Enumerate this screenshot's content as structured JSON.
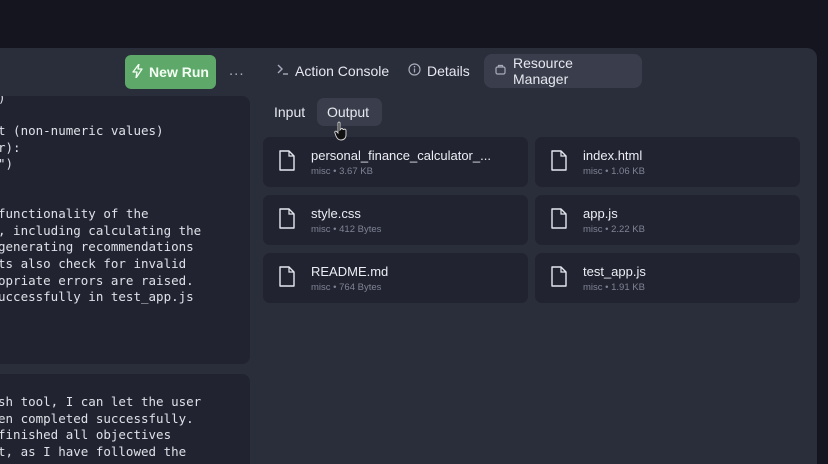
{
  "header": {
    "new_run_label": "New Run",
    "more_label": "...",
    "tabs": [
      {
        "label": "Action Console",
        "icon": "console-icon"
      },
      {
        "label": "Details",
        "icon": "info-icon"
      },
      {
        "label": "Resource Manager",
        "icon": "package-icon",
        "active": true
      }
    ]
  },
  "chat": {
    "message1_lines": [
      ")",
      "",
      "t (non-numeric values)",
      "r):",
      "\")",
      "",
      "",
      "functionality of the",
      ", including calculating the",
      "generating recommendations",
      "ts also check for invalid",
      "opriate errors are raised.",
      "uccessfully in test_app.js"
    ],
    "message2_lines": [
      "sh tool, I can let the user",
      "en completed successfully.",
      "finished all objectives",
      "t, as I have followed the"
    ]
  },
  "resources": {
    "subtabs": [
      {
        "label": "Input",
        "active": false
      },
      {
        "label": "Output",
        "active": true
      }
    ],
    "files": [
      {
        "name": "personal_finance_calculator_...",
        "meta": "misc • 3.67 KB"
      },
      {
        "name": "index.html",
        "meta": "misc • 1.06 KB"
      },
      {
        "name": "style.css",
        "meta": "misc • 412 Bytes"
      },
      {
        "name": "app.js",
        "meta": "misc • 2.22 KB"
      },
      {
        "name": "README.md",
        "meta": "misc • 764 Bytes"
      },
      {
        "name": "test_app.js",
        "meta": "misc • 1.91 KB"
      }
    ]
  }
}
